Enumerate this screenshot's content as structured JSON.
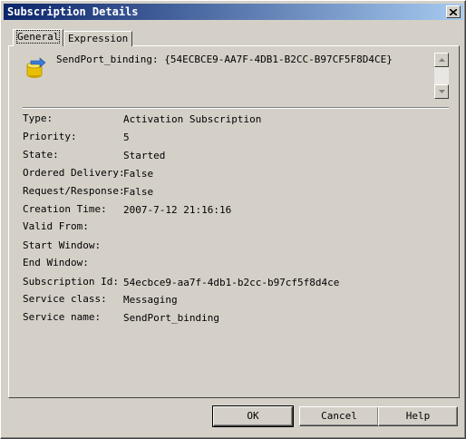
{
  "window": {
    "title": "Subscription Details"
  },
  "tabs": [
    {
      "label": "General",
      "active": true
    },
    {
      "label": "Expression",
      "active": false
    }
  ],
  "header": {
    "icon": "send-port-icon",
    "text": "SendPort_binding: {54ECBCE9-AA7F-4DB1-B2CC-B97CF5F8D4CE}"
  },
  "properties": [
    {
      "label": "Type:",
      "value": "Activation Subscription"
    },
    {
      "label": "Priority:",
      "value": "5"
    },
    {
      "label": "State:",
      "value": "Started"
    },
    {
      "label": "Ordered Delivery:",
      "value": "False"
    },
    {
      "label": "Request/Response:",
      "value": "False"
    },
    {
      "label": "Creation Time:",
      "value": "2007-7-12 21:16:16"
    },
    {
      "label": "Valid From:",
      "value": ""
    },
    {
      "label": "Start Window:",
      "value": ""
    },
    {
      "label": "End Window:",
      "value": ""
    },
    {
      "label": "Subscription Id:",
      "value": "54ecbce9-aa7f-4db1-b2cc-b97cf5f8d4ce"
    },
    {
      "label": "Service class:",
      "value": "Messaging"
    },
    {
      "label": "Service name:",
      "value": "SendPort_binding"
    }
  ],
  "buttons": {
    "ok": "OK",
    "cancel": "Cancel",
    "help": "Help"
  },
  "colors": {
    "titlebar_start": "#0a246a",
    "titlebar_end": "#a6caf0",
    "face": "#d4d0c8"
  }
}
